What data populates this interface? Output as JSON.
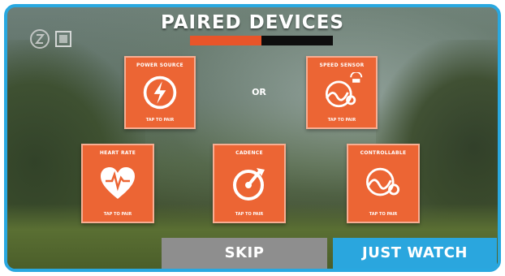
{
  "screen": {
    "title": "PAIRED DEVICES",
    "progress": {
      "left_label": "",
      "right_label": ""
    }
  },
  "divider": {
    "or_label": "OR"
  },
  "cards": {
    "power_source": {
      "label": "POWER SOURCE",
      "status": "TAP TO PAIR",
      "icon": "lightning-icon"
    },
    "speed_sensor": {
      "label": "SPEED SENSOR",
      "status": "TAP TO PAIR",
      "icon": "speed-sensor-icon"
    },
    "heart_rate": {
      "label": "HEART RATE",
      "status": "TAP TO PAIR",
      "icon": "heart-icon"
    },
    "cadence": {
      "label": "CADENCE",
      "status": "TAP TO PAIR",
      "icon": "cadence-icon"
    },
    "controllable": {
      "label": "CONTROLLABLE",
      "status": "TAP TO PAIR",
      "icon": "controllable-icon"
    }
  },
  "buttons": {
    "skip": "SKIP",
    "just_watch": "JUST WATCH"
  },
  "colors": {
    "card": "#ec6534",
    "accent_blue": "#29a8e0",
    "skip_gray": "#8e8e8e"
  }
}
